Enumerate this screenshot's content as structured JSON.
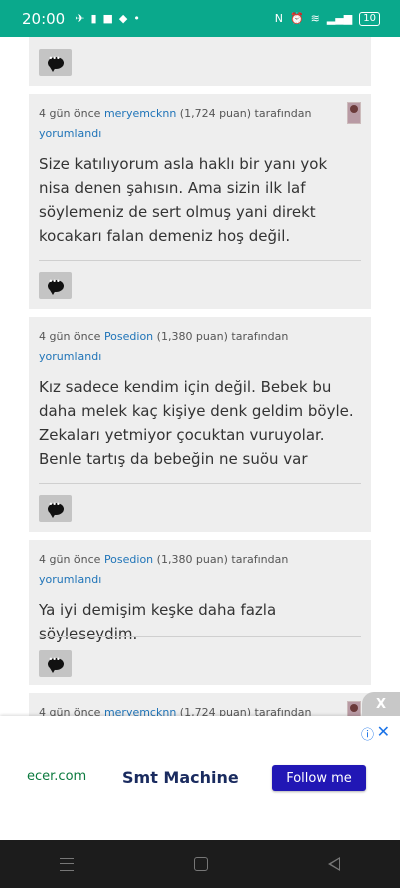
{
  "status_bar": {
    "time": "20:00",
    "battery": "10"
  },
  "comments": [
    {
      "time": "4 gün önce",
      "user": "meryemcknn",
      "points": "(1,724 puan)",
      "suffix": "tarafından",
      "action": "yorumlandı",
      "text": "Size katılıyorum asla haklı bir yanı yok nisa denen şahısın. Ama sizin ilk laf söylemeniz de sert olmuş yani direkt kocakarı falan demeniz hoş değil."
    },
    {
      "time": "4 gün önce",
      "user": "Posedion",
      "points": "(1,380 puan)",
      "suffix": "tarafından",
      "action": "yorumlandı",
      "text": "Kız sadece kendim için değil. Bebek bu daha melek kaç kişiye denk geldim böyle. Zekaları yetmiyor çocuktan vuruyolar. Benle tartış da bebeğin ne suöu var"
    },
    {
      "time": "4 gün önce",
      "user": "Posedion",
      "points": "(1,380 puan)",
      "suffix": "tarafından",
      "action": "yorumlandı",
      "text": "Ya iyi demişim keşke daha fazla söyleseydim."
    },
    {
      "time": "4 gün önce",
      "user": "meryemcknn",
      "points": "(1,724 puan)",
      "suffix": "tarafından"
    }
  ],
  "ad": {
    "close_tab": "X",
    "logo": "ecer.com",
    "title": "Smt Machine",
    "button": "Follow me"
  }
}
